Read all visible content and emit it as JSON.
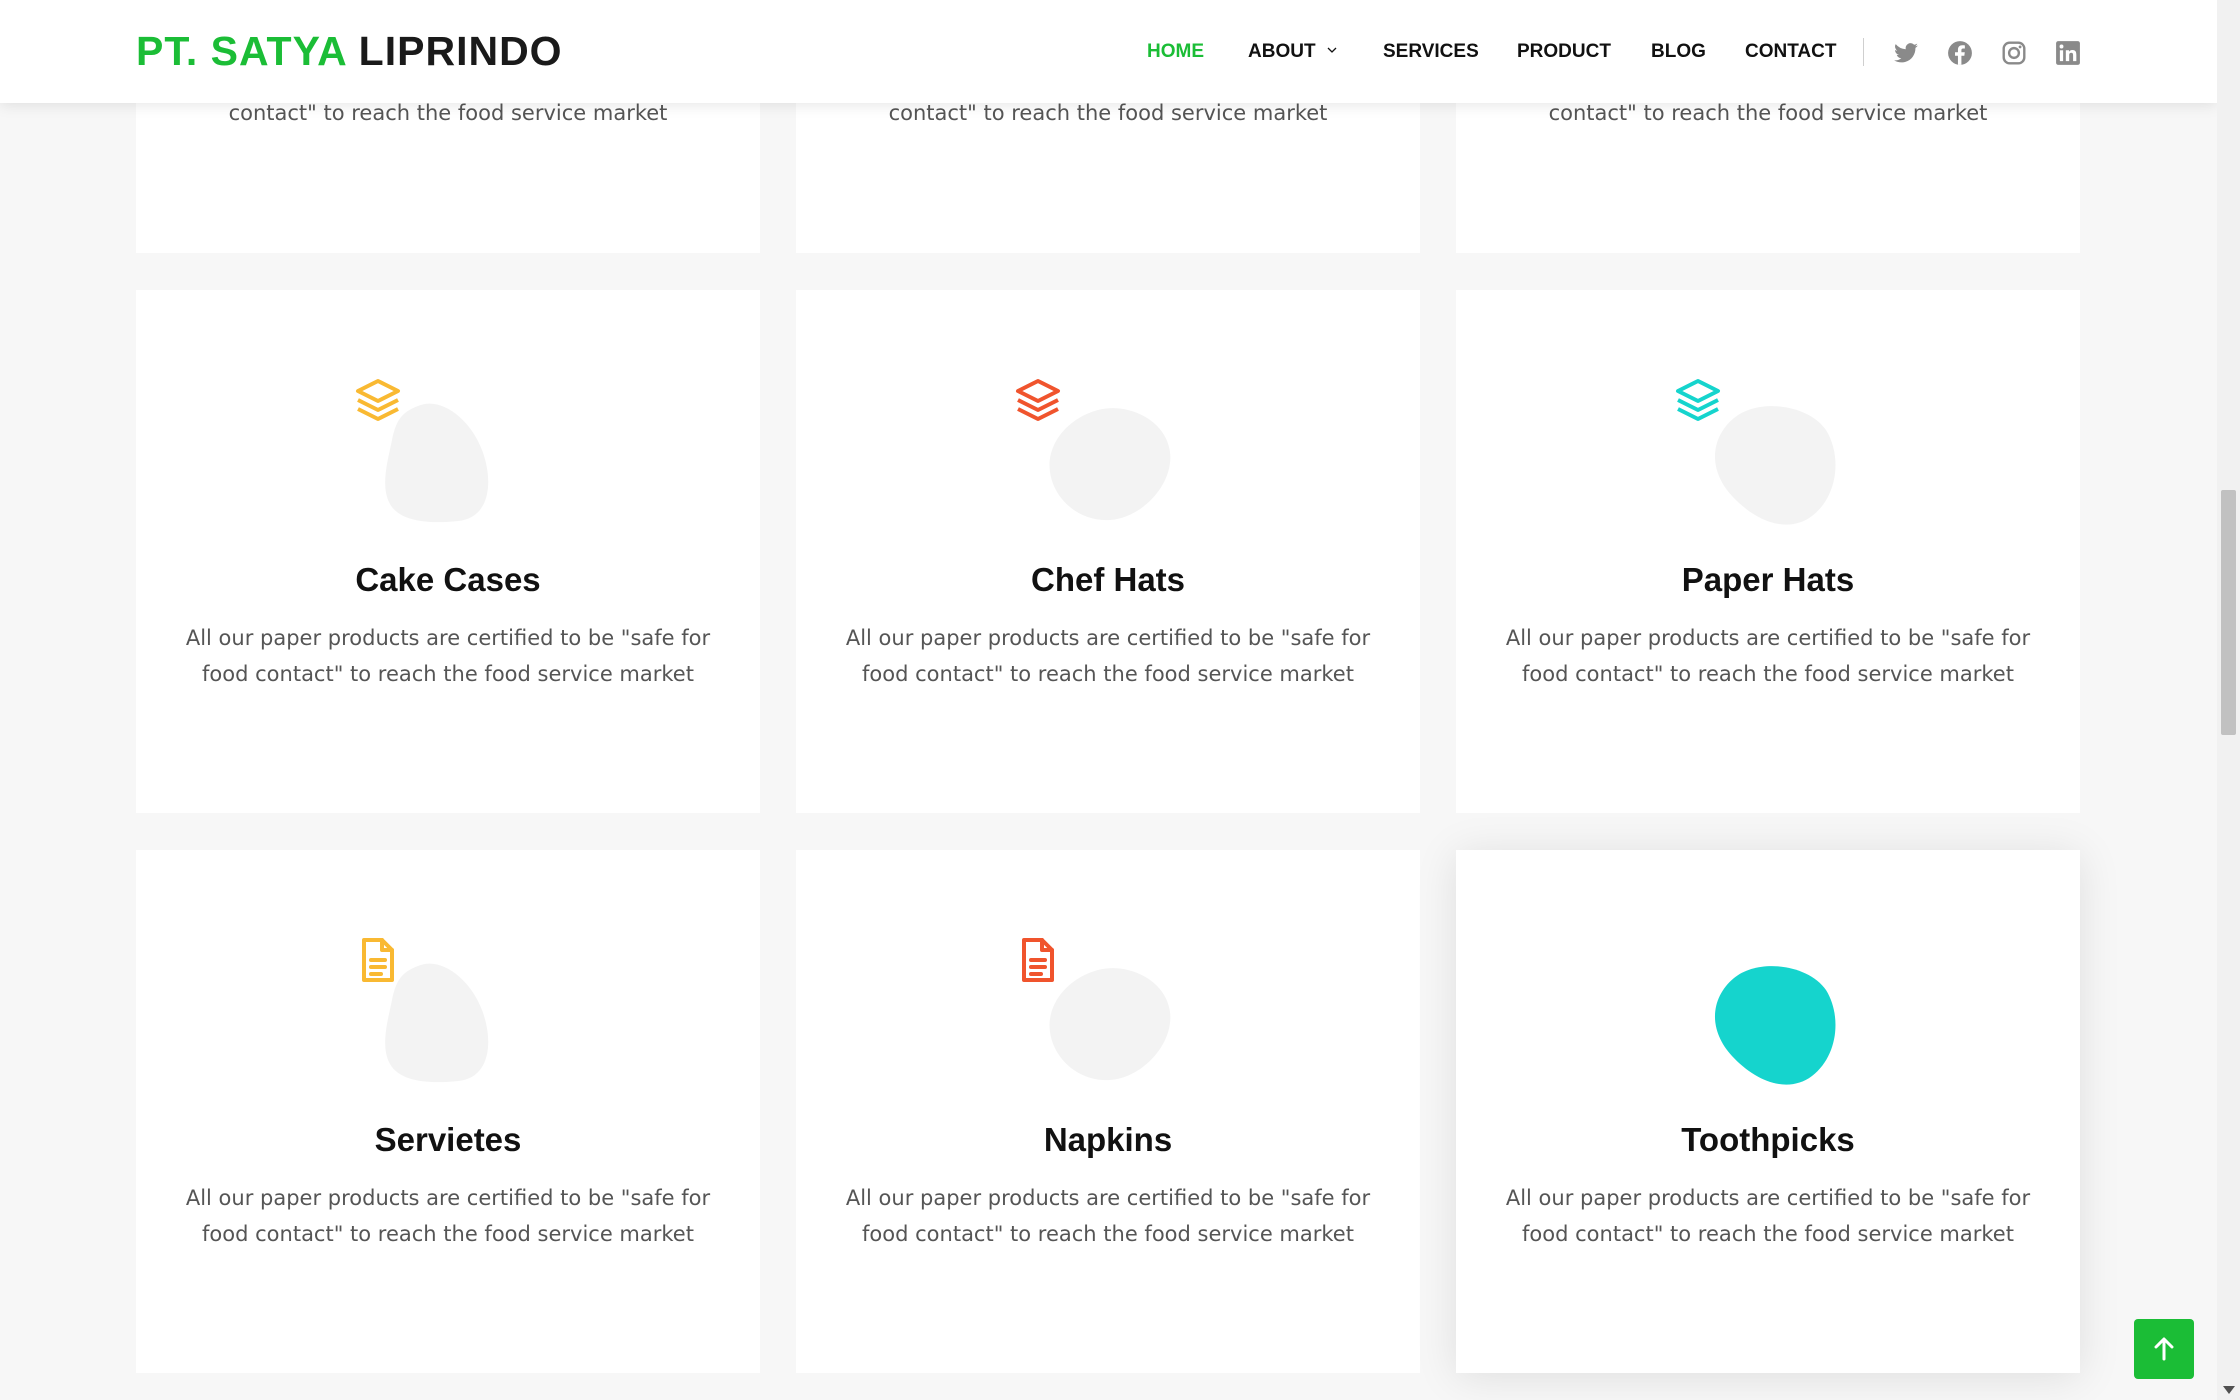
{
  "header": {
    "logo": {
      "part1": "PT. SATYA",
      "part2": "LIPRINDO"
    },
    "nav": {
      "home": "HOME",
      "about": "ABOUT",
      "services": "SERVICES",
      "product": "PRODUCT",
      "blog": "BLOG",
      "contact": "CONTACT"
    },
    "social": [
      "twitter-icon",
      "facebook-icon",
      "instagram-icon",
      "linkedin-icon"
    ]
  },
  "colors": {
    "brand_green": "#1bbd36",
    "yellow": "#f9b932",
    "orange": "#f0542d",
    "teal": "#15d4cd",
    "blob_bg": "#f3f3f3"
  },
  "partial_row": {
    "line": "contact\" to reach the food service market"
  },
  "cards": [
    {
      "title": "Cake Cases",
      "desc": "All our paper products are certified to be \"safe for food contact\" to reach the food service market",
      "icon": "layers-icon",
      "color": "yellow"
    },
    {
      "title": "Chef Hats",
      "desc": "All our paper products are certified to be \"safe for food contact\" to reach the food service market",
      "icon": "layers-icon",
      "color": "orange"
    },
    {
      "title": "Paper Hats",
      "desc": "All our paper products are certified to be \"safe for food contact\" to reach the food service market",
      "icon": "layers-icon",
      "color": "teal"
    },
    {
      "title": "Servietes",
      "desc": "All our paper products are certified to be \"safe for food contact\" to reach the food service market",
      "icon": "document-icon",
      "color": "yellow"
    },
    {
      "title": "Napkins",
      "desc": "All our paper products are certified to be \"safe for food contact\" to reach the food service market",
      "icon": "document-icon",
      "color": "orange"
    },
    {
      "title": "Toothpicks",
      "desc": "All our paper products are certified to be \"safe for food contact\" to reach the food service market",
      "icon": "document-icon",
      "color": "teal",
      "hovered": true
    }
  ]
}
